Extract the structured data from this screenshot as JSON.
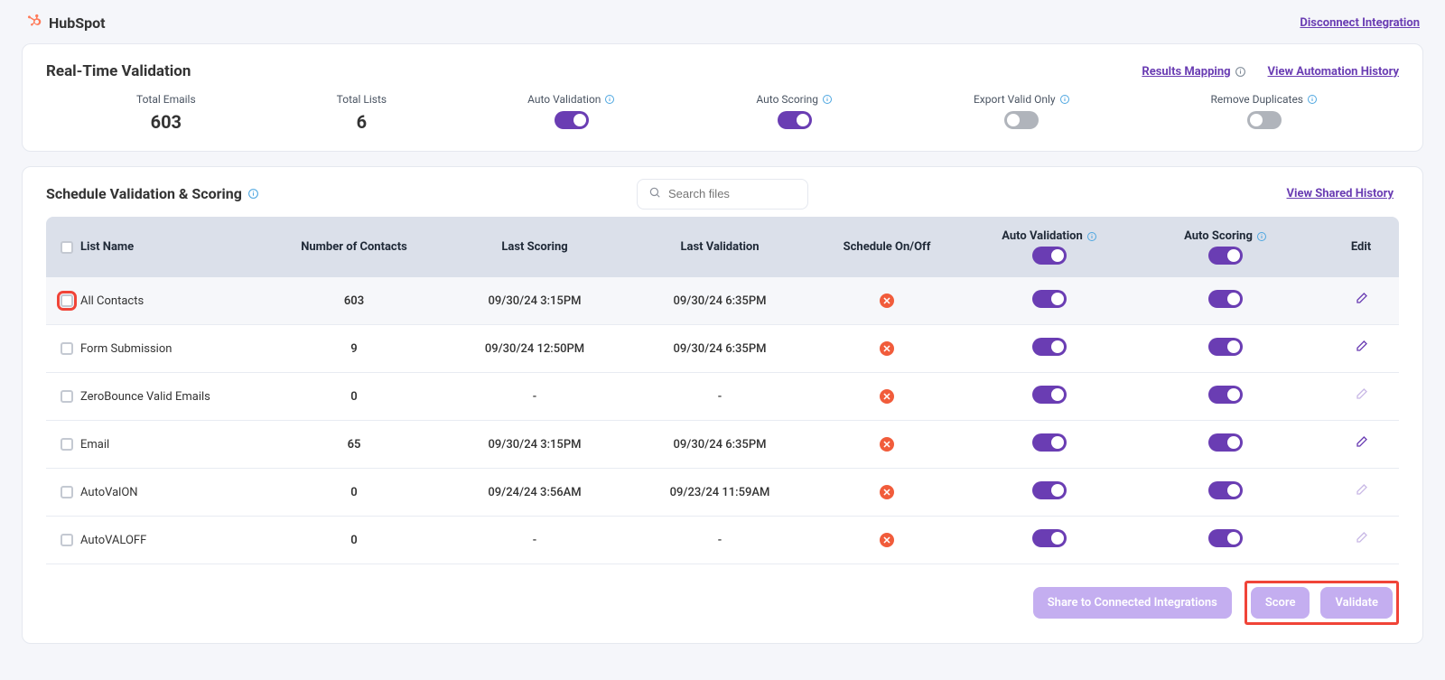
{
  "header": {
    "brand": "HubSpot",
    "disconnect": "Disconnect Integration"
  },
  "realtime": {
    "title": "Real-Time Validation",
    "results_mapping": "Results Mapping",
    "view_history": "View Automation History",
    "stats": {
      "total_emails_label": "Total Emails",
      "total_emails_value": "603",
      "total_lists_label": "Total Lists",
      "total_lists_value": "6",
      "auto_validation_label": "Auto Validation",
      "auto_scoring_label": "Auto Scoring",
      "export_valid_label": "Export Valid Only",
      "remove_dups_label": "Remove Duplicates"
    }
  },
  "schedule": {
    "title": "Schedule Validation & Scoring",
    "search_placeholder": "Search files",
    "view_shared_history": "View Shared History"
  },
  "columns": {
    "list_name": "List Name",
    "contacts": "Number of Contacts",
    "last_scoring": "Last Scoring",
    "last_validation": "Last Validation",
    "schedule": "Schedule On/Off",
    "auto_validation": "Auto Validation",
    "auto_scoring": "Auto Scoring",
    "edit": "Edit"
  },
  "rows": [
    {
      "name": "All Contacts",
      "contacts": "603",
      "last_scoring": "09/30/24 3:15PM",
      "last_validation": "09/30/24 6:35PM",
      "edit_dim": false
    },
    {
      "name": "Form Submission",
      "contacts": "9",
      "last_scoring": "09/30/24 12:50PM",
      "last_validation": "09/30/24 6:35PM",
      "edit_dim": false
    },
    {
      "name": "ZeroBounce Valid Emails",
      "contacts": "0",
      "last_scoring": "-",
      "last_validation": "-",
      "edit_dim": true
    },
    {
      "name": "Email",
      "contacts": "65",
      "last_scoring": "09/30/24 3:15PM",
      "last_validation": "09/30/24 6:35PM",
      "edit_dim": false
    },
    {
      "name": "AutoValON",
      "contacts": "0",
      "last_scoring": "09/24/24 3:56AM",
      "last_validation": "09/23/24 11:59AM",
      "edit_dim": true
    },
    {
      "name": "AutoVALOFF",
      "contacts": "0",
      "last_scoring": "-",
      "last_validation": "-",
      "edit_dim": true
    }
  ],
  "footer": {
    "share": "Share to Connected Integrations",
    "score": "Score",
    "validate": "Validate"
  }
}
